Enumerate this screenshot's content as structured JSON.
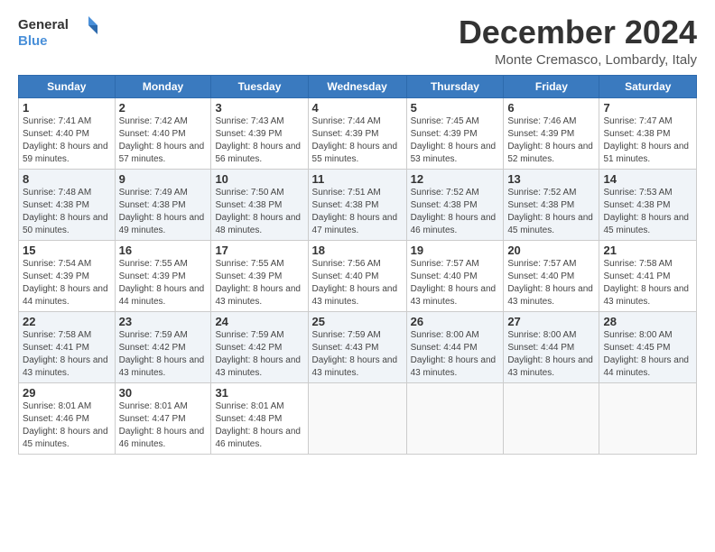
{
  "logo": {
    "line1": "General",
    "line2": "Blue"
  },
  "title": "December 2024",
  "location": "Monte Cremasco, Lombardy, Italy",
  "headers": [
    "Sunday",
    "Monday",
    "Tuesday",
    "Wednesday",
    "Thursday",
    "Friday",
    "Saturday"
  ],
  "weeks": [
    [
      {
        "day": "1",
        "sunrise": "7:41 AM",
        "sunset": "4:40 PM",
        "daylight": "8 hours and 59 minutes."
      },
      {
        "day": "2",
        "sunrise": "7:42 AM",
        "sunset": "4:40 PM",
        "daylight": "8 hours and 57 minutes."
      },
      {
        "day": "3",
        "sunrise": "7:43 AM",
        "sunset": "4:39 PM",
        "daylight": "8 hours and 56 minutes."
      },
      {
        "day": "4",
        "sunrise": "7:44 AM",
        "sunset": "4:39 PM",
        "daylight": "8 hours and 55 minutes."
      },
      {
        "day": "5",
        "sunrise": "7:45 AM",
        "sunset": "4:39 PM",
        "daylight": "8 hours and 53 minutes."
      },
      {
        "day": "6",
        "sunrise": "7:46 AM",
        "sunset": "4:39 PM",
        "daylight": "8 hours and 52 minutes."
      },
      {
        "day": "7",
        "sunrise": "7:47 AM",
        "sunset": "4:38 PM",
        "daylight": "8 hours and 51 minutes."
      }
    ],
    [
      {
        "day": "8",
        "sunrise": "7:48 AM",
        "sunset": "4:38 PM",
        "daylight": "8 hours and 50 minutes."
      },
      {
        "day": "9",
        "sunrise": "7:49 AM",
        "sunset": "4:38 PM",
        "daylight": "8 hours and 49 minutes."
      },
      {
        "day": "10",
        "sunrise": "7:50 AM",
        "sunset": "4:38 PM",
        "daylight": "8 hours and 48 minutes."
      },
      {
        "day": "11",
        "sunrise": "7:51 AM",
        "sunset": "4:38 PM",
        "daylight": "8 hours and 47 minutes."
      },
      {
        "day": "12",
        "sunrise": "7:52 AM",
        "sunset": "4:38 PM",
        "daylight": "8 hours and 46 minutes."
      },
      {
        "day": "13",
        "sunrise": "7:52 AM",
        "sunset": "4:38 PM",
        "daylight": "8 hours and 45 minutes."
      },
      {
        "day": "14",
        "sunrise": "7:53 AM",
        "sunset": "4:38 PM",
        "daylight": "8 hours and 45 minutes."
      }
    ],
    [
      {
        "day": "15",
        "sunrise": "7:54 AM",
        "sunset": "4:39 PM",
        "daylight": "8 hours and 44 minutes."
      },
      {
        "day": "16",
        "sunrise": "7:55 AM",
        "sunset": "4:39 PM",
        "daylight": "8 hours and 44 minutes."
      },
      {
        "day": "17",
        "sunrise": "7:55 AM",
        "sunset": "4:39 PM",
        "daylight": "8 hours and 43 minutes."
      },
      {
        "day": "18",
        "sunrise": "7:56 AM",
        "sunset": "4:40 PM",
        "daylight": "8 hours and 43 minutes."
      },
      {
        "day": "19",
        "sunrise": "7:57 AM",
        "sunset": "4:40 PM",
        "daylight": "8 hours and 43 minutes."
      },
      {
        "day": "20",
        "sunrise": "7:57 AM",
        "sunset": "4:40 PM",
        "daylight": "8 hours and 43 minutes."
      },
      {
        "day": "21",
        "sunrise": "7:58 AM",
        "sunset": "4:41 PM",
        "daylight": "8 hours and 43 minutes."
      }
    ],
    [
      {
        "day": "22",
        "sunrise": "7:58 AM",
        "sunset": "4:41 PM",
        "daylight": "8 hours and 43 minutes."
      },
      {
        "day": "23",
        "sunrise": "7:59 AM",
        "sunset": "4:42 PM",
        "daylight": "8 hours and 43 minutes."
      },
      {
        "day": "24",
        "sunrise": "7:59 AM",
        "sunset": "4:42 PM",
        "daylight": "8 hours and 43 minutes."
      },
      {
        "day": "25",
        "sunrise": "7:59 AM",
        "sunset": "4:43 PM",
        "daylight": "8 hours and 43 minutes."
      },
      {
        "day": "26",
        "sunrise": "8:00 AM",
        "sunset": "4:44 PM",
        "daylight": "8 hours and 43 minutes."
      },
      {
        "day": "27",
        "sunrise": "8:00 AM",
        "sunset": "4:44 PM",
        "daylight": "8 hours and 43 minutes."
      },
      {
        "day": "28",
        "sunrise": "8:00 AM",
        "sunset": "4:45 PM",
        "daylight": "8 hours and 44 minutes."
      }
    ],
    [
      {
        "day": "29",
        "sunrise": "8:01 AM",
        "sunset": "4:46 PM",
        "daylight": "8 hours and 45 minutes."
      },
      {
        "day": "30",
        "sunrise": "8:01 AM",
        "sunset": "4:47 PM",
        "daylight": "8 hours and 46 minutes."
      },
      {
        "day": "31",
        "sunrise": "8:01 AM",
        "sunset": "4:48 PM",
        "daylight": "8 hours and 46 minutes."
      },
      null,
      null,
      null,
      null
    ]
  ],
  "labels": {
    "sunrise": "Sunrise:",
    "sunset": "Sunset:",
    "daylight": "Daylight:"
  }
}
